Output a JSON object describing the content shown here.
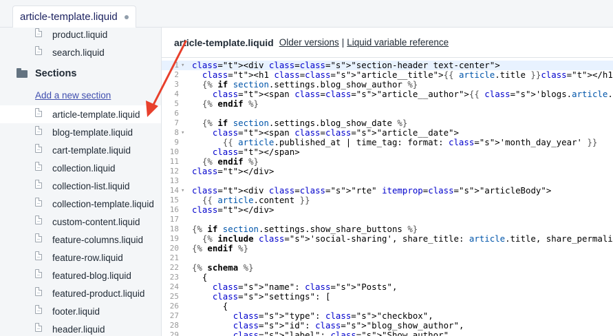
{
  "tab": {
    "label": "article-template.liquid"
  },
  "sidebar": {
    "top_files": [
      "product.liquid",
      "search.liquid"
    ],
    "section_title": "Sections",
    "add_section": "Add a new section",
    "section_files": [
      "article-template.liquid",
      "blog-template.liquid",
      "cart-template.liquid",
      "collection.liquid",
      "collection-list.liquid",
      "collection-template.liquid",
      "custom-content.liquid",
      "feature-columns.liquid",
      "feature-row.liquid",
      "featured-blog.liquid",
      "featured-product.liquid",
      "footer.liquid",
      "header.liquid"
    ],
    "active_file": "article-template.liquid"
  },
  "main": {
    "title": "article-template.liquid",
    "older_versions": "Older versions",
    "separator": "|",
    "variable_reference": "Liquid variable reference"
  },
  "code_lines": [
    {
      "n": "1",
      "fold": "▾"
    },
    {
      "n": "2"
    },
    {
      "n": "3"
    },
    {
      "n": "4"
    },
    {
      "n": "5"
    },
    {
      "n": "6"
    },
    {
      "n": "7"
    },
    {
      "n": "8",
      "fold": "▾"
    },
    {
      "n": "9"
    },
    {
      "n": "10"
    },
    {
      "n": "11"
    },
    {
      "n": "12"
    },
    {
      "n": "13"
    },
    {
      "n": "14",
      "fold": "▾"
    },
    {
      "n": "15"
    },
    {
      "n": "16"
    },
    {
      "n": "17"
    },
    {
      "n": "18"
    },
    {
      "n": "19"
    },
    {
      "n": "20"
    },
    {
      "n": "21"
    },
    {
      "n": "22"
    },
    {
      "n": "23"
    },
    {
      "n": "24"
    },
    {
      "n": "25"
    },
    {
      "n": "26"
    },
    {
      "n": "27"
    },
    {
      "n": "28"
    },
    {
      "n": "29"
    }
  ],
  "code_text": [
    "<div class=\"section-header text-center\">",
    "  <h1 class=\"article__title\">{{ article.title }}</h1>",
    "  {% if section.settings.blog_show_author %}",
    "    <span class=\"article__author\">{{ 'blogs.article.by_author' | t: autho",
    "  {% endif %}",
    "",
    "  {% if section.settings.blog_show_date %}",
    "    <span class=\"article__date\">",
    "      {{ article.published_at | time_tag: format: 'month_day_year' }}",
    "    </span>",
    "  {% endif %}",
    "</div>",
    "",
    "<div class=\"rte\" itemprop=\"articleBody\">",
    "  {{ article.content }}",
    "</div>",
    "",
    "{% if section.settings.show_share_buttons %}",
    "  {% include 'social-sharing', share_title: article.title, share_permalin",
    "{% endif %}",
    "",
    "{% schema %}",
    "  {",
    "    \"name\": \"Posts\",",
    "    \"settings\": [",
    "      {",
    "        \"type\": \"checkbox\",",
    "        \"id\": \"blog_show_author\",",
    "        \"label\": \"Show author\","
  ],
  "colors": {
    "arrow": "#e8402c",
    "link": "#3f4eae",
    "sidebar_bg": "#f4f6f8"
  },
  "icons": {
    "folder": "folder-icon",
    "file": "file-icon",
    "arrow": "annotation-arrow-icon"
  }
}
